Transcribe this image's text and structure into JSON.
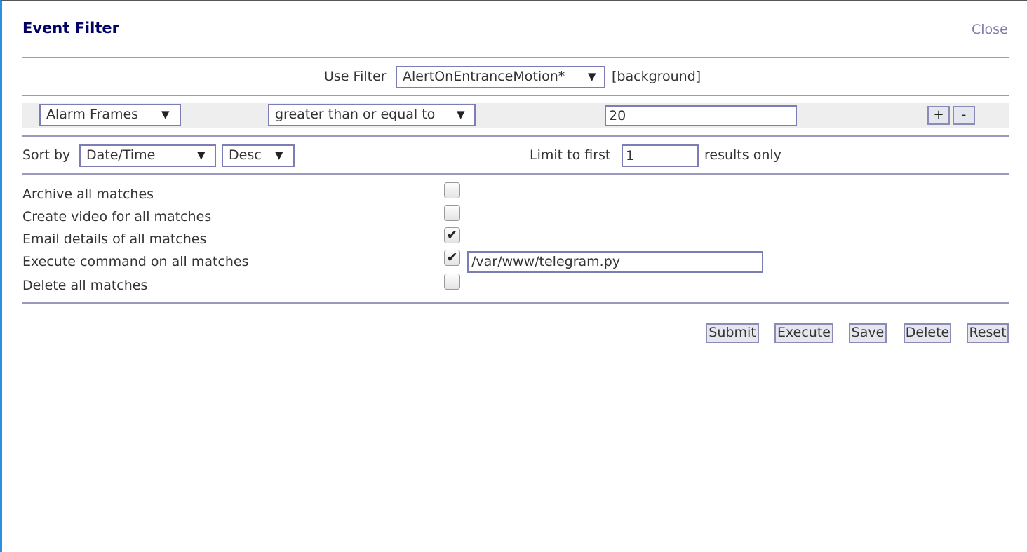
{
  "dialog": {
    "title": "Event Filter",
    "close_label": "Close"
  },
  "use_filter": {
    "label": "Use Filter",
    "selected": "AlertOnEntranceMotion*",
    "tag": "[background]"
  },
  "term": {
    "attribute": "Alarm Frames",
    "operator": "greater than or equal to",
    "value": "20",
    "add_label": "+",
    "remove_label": "-"
  },
  "sort": {
    "label": "Sort by",
    "field": "Date/Time",
    "direction": "Desc",
    "limit_label": "Limit to first",
    "limit_value": "1",
    "limit_suffix": "results only"
  },
  "actions": [
    {
      "label": "Archive all matches",
      "checked": false
    },
    {
      "label": "Create video for all matches",
      "checked": false
    },
    {
      "label": "Email details of all matches",
      "checked": true
    },
    {
      "label": "Execute command on all matches",
      "checked": true,
      "command": "/var/www/telegram.py"
    },
    {
      "label": "Delete all matches",
      "checked": false
    }
  ],
  "buttons": {
    "submit": "Submit",
    "execute": "Execute",
    "save": "Save",
    "delete": "Delete",
    "reset": "Reset"
  },
  "glyphs": {
    "dropdown_arrow": "▼",
    "check": "✔"
  },
  "colors": {
    "title": "#000066",
    "border": "#7d7db5",
    "accent_edge": "#2d8fe0"
  }
}
